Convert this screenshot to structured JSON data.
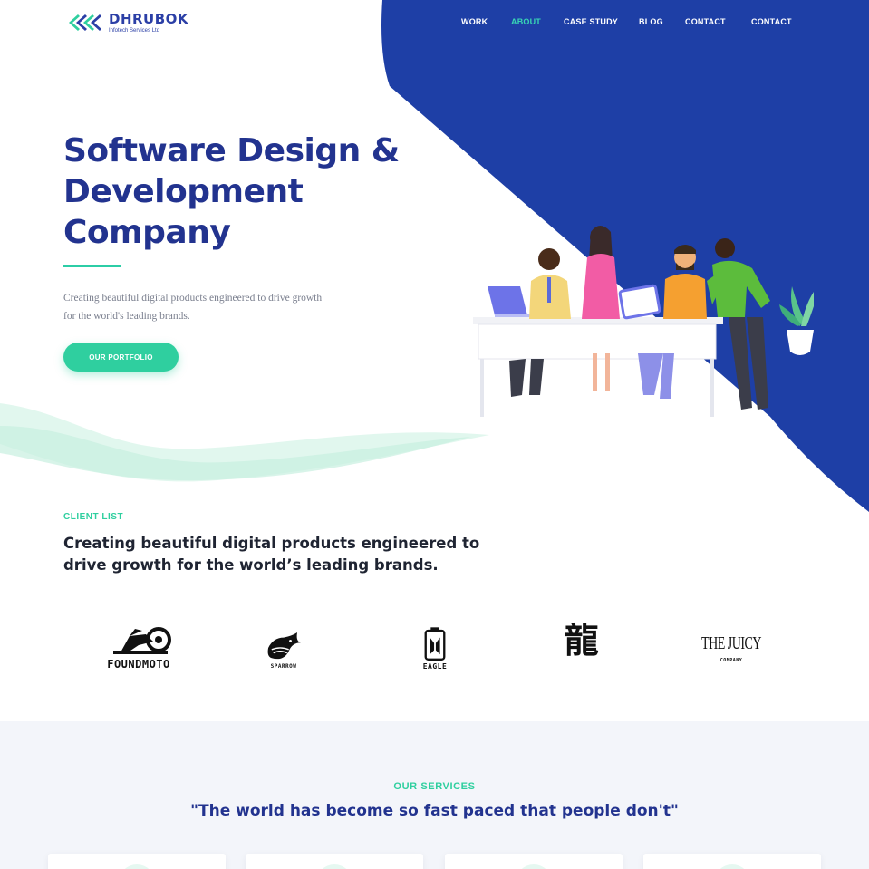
{
  "brand": {
    "name": "DHRUBOK",
    "tagline": "Infotech Services Ltd",
    "logo_icon": "chevron-arrows-logo"
  },
  "colors": {
    "primary_blue": "#1e3fa6",
    "heading_blue": "#22338f",
    "accent_green": "#2fcf9f",
    "services_bg": "#f3f5fa"
  },
  "nav": {
    "items": [
      {
        "label": "WORK",
        "active": false
      },
      {
        "label": "ABOUT",
        "active": true
      },
      {
        "label": "CASE STUDY",
        "active": false
      },
      {
        "label": "BLOG",
        "active": false
      },
      {
        "label": "CONTACT",
        "active": false
      },
      {
        "label": "CONTACT",
        "active": false
      }
    ]
  },
  "hero": {
    "title_line1": "Software Design &",
    "title_line2": "Development",
    "title_line3": "Company",
    "subtitle": "Creating beautiful digital products engineered to drive growth for the world's leading brands.",
    "cta_label": "OUR PORTFOLIO",
    "illustration": "team-at-desk-illustration"
  },
  "clients": {
    "eyebrow": "CLIENT LIST",
    "heading": "Creating beautiful digital products engineered to drive growth for the world’s leading brands.",
    "logos": [
      {
        "name": "FOUNDMOTO",
        "icon": "motorcycle-icon"
      },
      {
        "name": "SPARROW",
        "icon": "sparrow-bird-icon"
      },
      {
        "name": "EAGLE",
        "icon": "eagle-icon"
      },
      {
        "name": "龍",
        "icon": "dragon-glyph-icon"
      },
      {
        "name": "THE JUICY",
        "sub": "COMPANY",
        "icon": "juicy-wordmark-icon"
      }
    ]
  },
  "services": {
    "eyebrow": "OUR SERVICES",
    "quote": "\"The world has become so fast paced that people don't\"",
    "cards": 4
  }
}
